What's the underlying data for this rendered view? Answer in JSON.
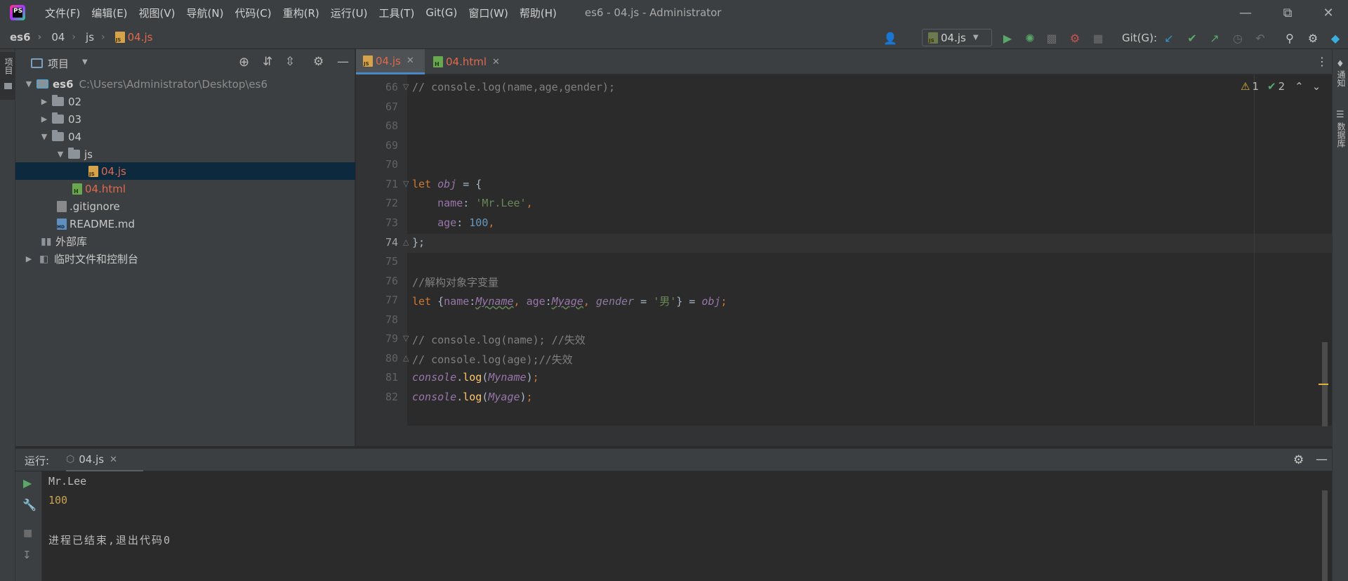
{
  "titlebar": {
    "logo_text": "PS",
    "menu": [
      "文件(F)",
      "编辑(E)",
      "视图(V)",
      "导航(N)",
      "代码(C)",
      "重构(R)",
      "运行(U)",
      "工具(T)",
      "Git(G)",
      "窗口(W)",
      "帮助(H)"
    ],
    "title": "es6 - 04.js - Administrator"
  },
  "breadcrumb": [
    "es6",
    "04",
    "js",
    "04.js"
  ],
  "toolbar": {
    "run_config": "04.js",
    "git_label": "Git(G):"
  },
  "left_strip": {
    "project_tab": "项目"
  },
  "right_strip": {
    "notifications": "通知",
    "database": "数据库"
  },
  "project": {
    "title": "项目",
    "root_name": "es6",
    "root_path": "C:\\Users\\Administrator\\Desktop\\es6",
    "items": [
      {
        "label": "02"
      },
      {
        "label": "03"
      },
      {
        "label": "04"
      },
      {
        "label": "js"
      },
      {
        "label": "04.js"
      },
      {
        "label": "04.html"
      },
      {
        "label": ".gitignore"
      },
      {
        "label": "README.md"
      },
      {
        "label": "外部库"
      },
      {
        "label": "临时文件和控制台"
      }
    ]
  },
  "editor": {
    "tabs": [
      {
        "label": "04.js"
      },
      {
        "label": "04.html"
      }
    ],
    "inspections": {
      "warnings": "1",
      "weak_warnings": "2"
    },
    "line_numbers": [
      "66",
      "67",
      "68",
      "69",
      "70",
      "71",
      "72",
      "73",
      "74",
      "75",
      "76",
      "77",
      "78",
      "79",
      "80",
      "81",
      "82"
    ],
    "lines": {
      "l66": "// console.log(name,age,gender);",
      "l71_kw": "let",
      "l71_var": "obj",
      "l71_rest": " = {",
      "l72_prop": "name",
      "l72_str": "'Mr.Lee'",
      "l73_prop": "age",
      "l73_num": "100",
      "l74": "};",
      "l76": "//解构对象字变量",
      "l77_kw": "let",
      "l77_p1": "name",
      "l77_v1": "Myname",
      "l77_p2": "age",
      "l77_v2": "Myage",
      "l77_v3": "gender",
      "l77_str": "'男'",
      "l77_obj": "obj",
      "l79": "// console.log(name); //失效",
      "l80": "// console.log(age);//失效",
      "console": "console",
      "log": "log",
      "arg81": "Myname",
      "arg82": "Myage"
    }
  },
  "run_panel": {
    "label": "运行:",
    "tab": "04.js",
    "output": [
      "Mr.Lee",
      "100",
      "",
      "进程已结束,退出代码0"
    ]
  }
}
